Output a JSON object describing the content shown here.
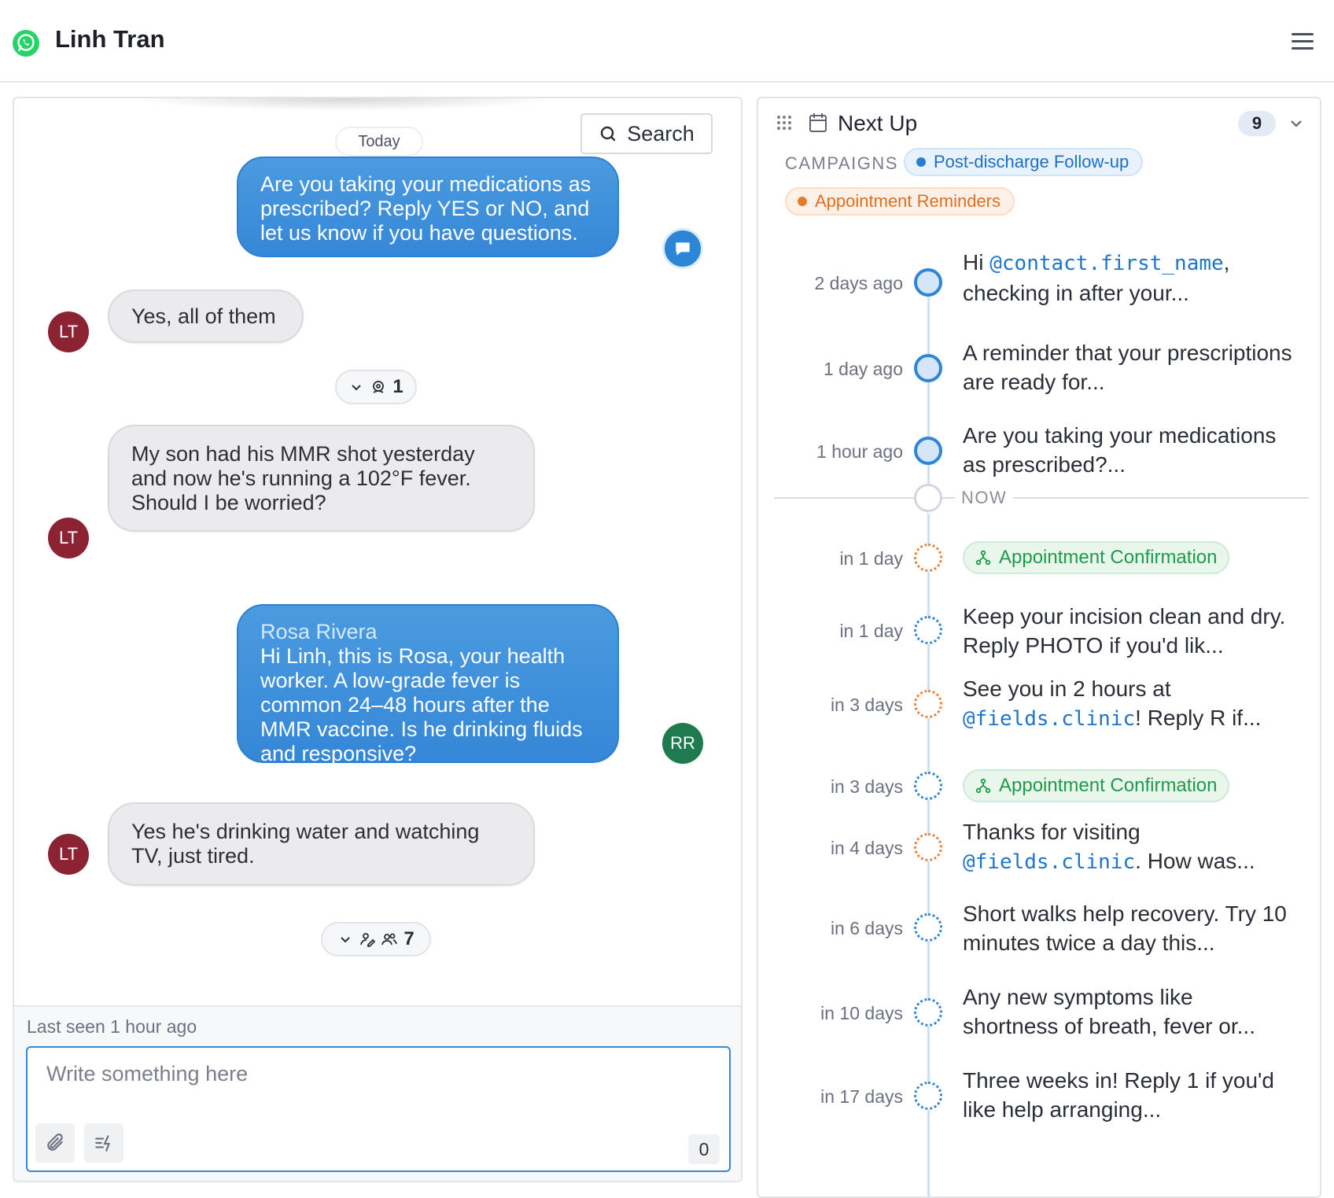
{
  "header": {
    "contact_name": "Linh Tran",
    "channel_icon": "whatsapp-icon",
    "menu_icon": "hamburger-menu-icon"
  },
  "chat": {
    "date_divider": "Today",
    "search_label": "Search",
    "messages": [
      {
        "direction": "outgoing",
        "sender": "",
        "avatar": "bot-icon",
        "text": "Are you taking your medications as prescribed? Reply YES or NO, and let us know if you have questions."
      },
      {
        "direction": "incoming",
        "avatar": "LT",
        "text": "Yes, all of them"
      },
      {
        "direction": "incoming",
        "avatar": "LT",
        "text": "My son had his MMR shot yesterday and now he's running a 102°F fever. Should I be worried?"
      },
      {
        "direction": "outgoing",
        "sender": "Rosa Rivera",
        "avatar": "RR",
        "text": "Hi Linh, this is Rosa, your health worker. A low-grade fever is common 24–48 hours after the MMR vaccine. Is he drinking fluids and responsive?"
      },
      {
        "direction": "incoming",
        "avatar": "LT",
        "text": "Yes he's drinking water and watching TV, just tired."
      }
    ],
    "collapsed_groups": [
      {
        "count": "1",
        "icons": [
          "chevron-down-icon",
          "agent-icon"
        ]
      },
      {
        "count": "7",
        "icons": [
          "chevron-down-icon",
          "edit-user-icon",
          "users-icon"
        ]
      }
    ],
    "last_seen": "Last seen 1 hour ago",
    "composer": {
      "placeholder": "Write something here",
      "char_count": "0"
    }
  },
  "next_up": {
    "title": "Next Up",
    "count": "9",
    "campaigns_label": "CAMPAIGNS",
    "campaigns": [
      {
        "name": "Post-discharge Follow-up",
        "color": "#2a7fd0"
      },
      {
        "name": "Appointment Reminders",
        "color": "#e87a2c"
      }
    ],
    "now_label": "NOW",
    "past": [
      {
        "time": "2 days ago",
        "pre": "Hi ",
        "var": "@contact.first_name",
        "post": ", checking in after your..."
      },
      {
        "time": "1 day ago",
        "text": "A reminder that your prescriptions are ready for..."
      },
      {
        "time": "1 hour ago",
        "text": "Are you taking your medications as prescribed?..."
      }
    ],
    "future": [
      {
        "time": "in 1 day",
        "campaign": "orange",
        "tag": "Appointment Confirmation"
      },
      {
        "time": "in 1 day",
        "campaign": "blue",
        "text": "Keep your incision clean and dry. Reply PHOTO if you'd lik..."
      },
      {
        "time": "in 3 days",
        "campaign": "orange",
        "pre": "See you in 2 hours at ",
        "var": "@fields.clinic",
        "post": "! Reply R if..."
      },
      {
        "time": "in 3 days",
        "campaign": "blue",
        "tag": "Appointment Confirmation"
      },
      {
        "time": "in 4 days",
        "campaign": "orange",
        "pre": "Thanks for visiting ",
        "var": "@fields.clinic",
        "post": ". How was..."
      },
      {
        "time": "in 6 days",
        "campaign": "blue",
        "text": "Short walks help recovery. Try 10 minutes twice a day this..."
      },
      {
        "time": "in 10 days",
        "campaign": "blue",
        "text": "Any new symptoms like shortness of breath, fever or..."
      },
      {
        "time": "in 17 days",
        "campaign": "blue",
        "text": "Three weeks in! Reply 1 if you'd like help arranging..."
      }
    ]
  },
  "colors": {
    "accent": "#3587d7",
    "avatar_lt": "#8c2332",
    "avatar_rr": "#1e7a4f",
    "whatsapp": "#25d366",
    "tag_green": "#1f9a4a"
  }
}
